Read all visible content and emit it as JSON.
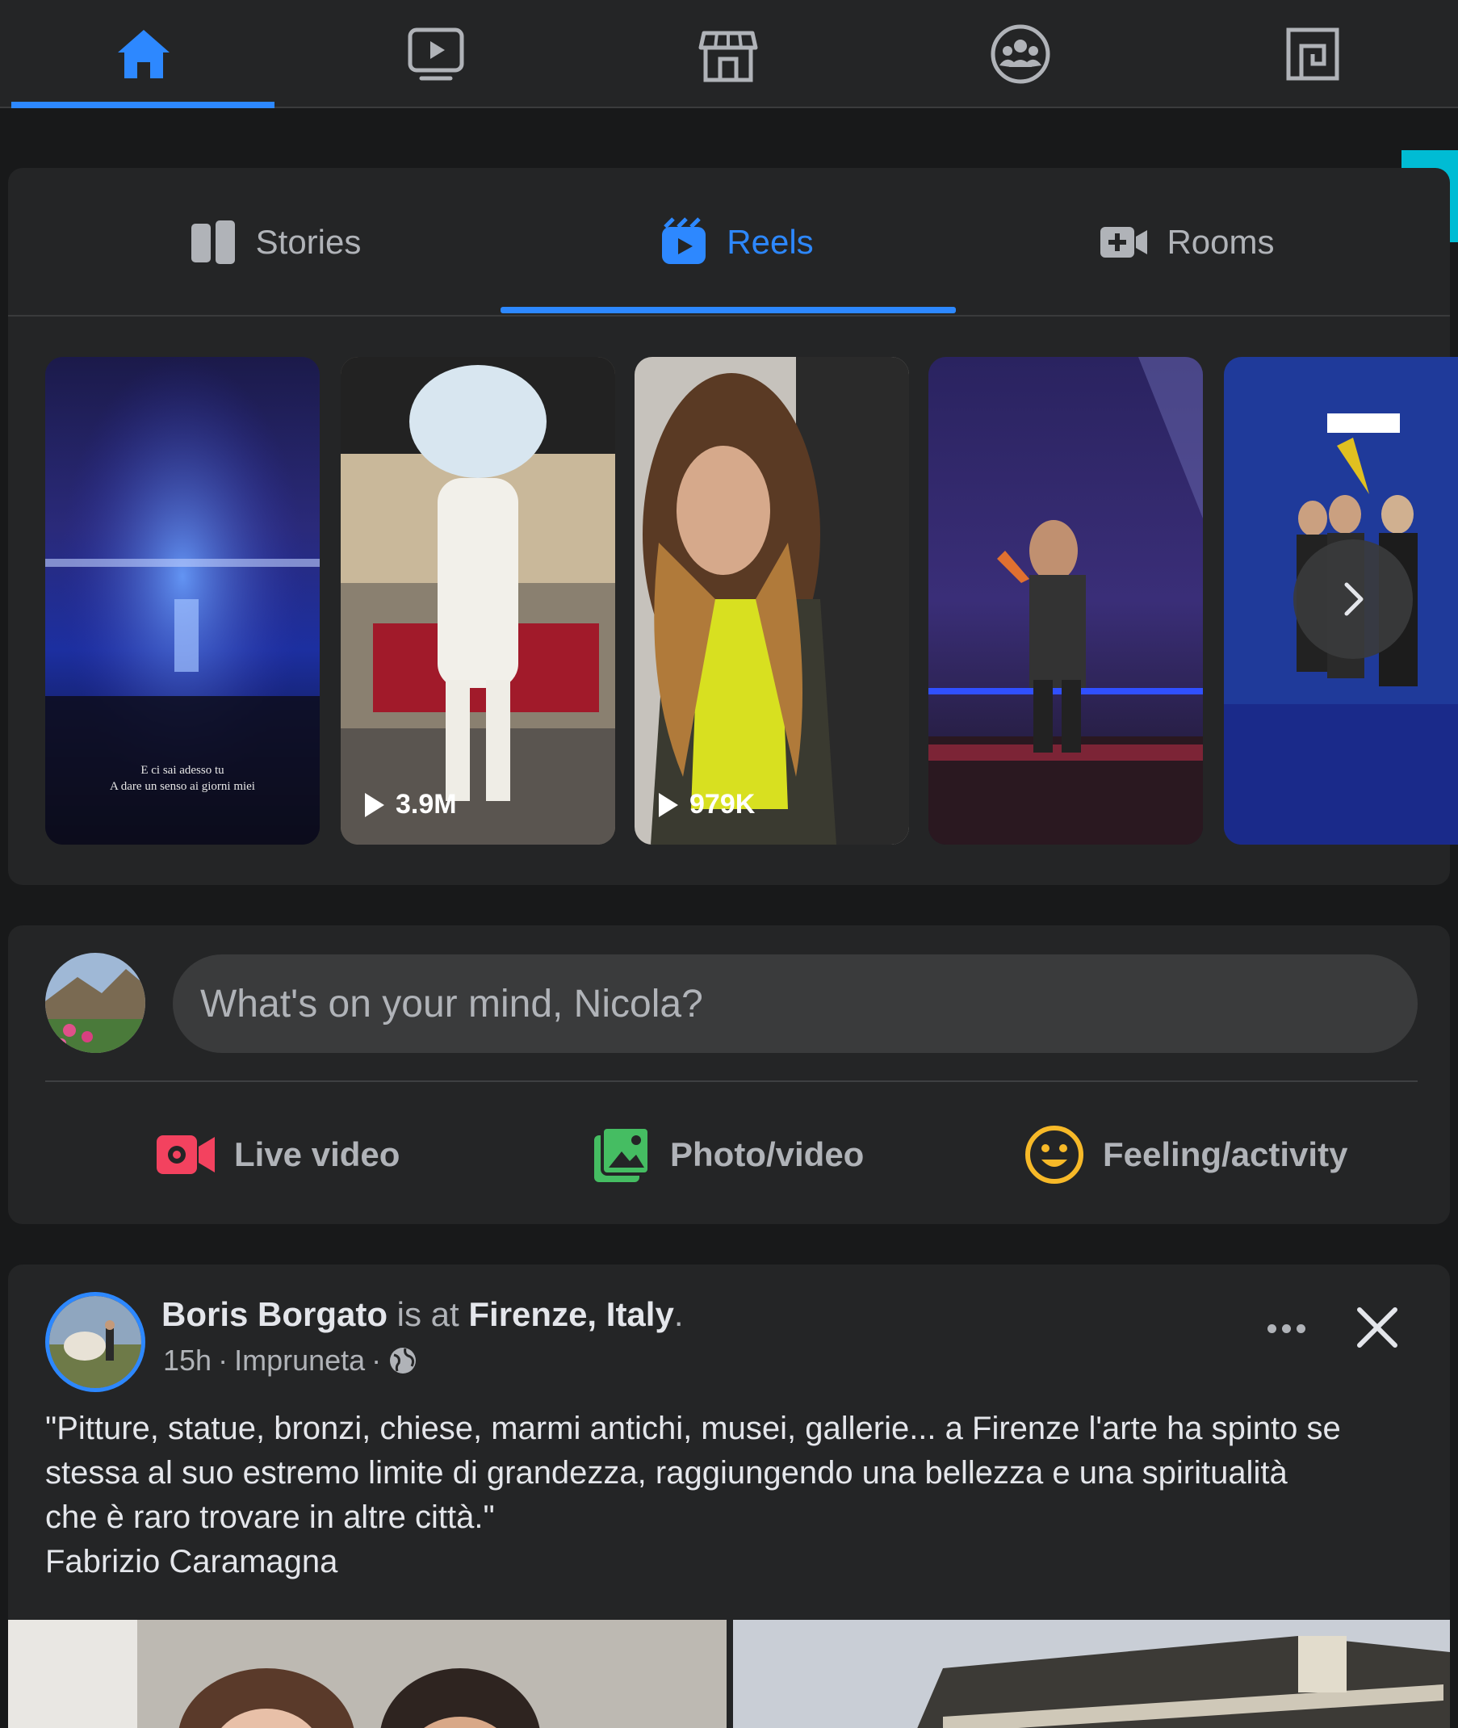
{
  "nav": {
    "items": [
      {
        "name": "home",
        "icon": "home-icon",
        "active": true
      },
      {
        "name": "watch",
        "icon": "video-play-icon",
        "active": false
      },
      {
        "name": "marketplace",
        "icon": "shop-icon",
        "active": false
      },
      {
        "name": "groups",
        "icon": "groups-icon",
        "active": false
      },
      {
        "name": "gaming",
        "icon": "gaming-icon",
        "active": false
      }
    ],
    "accent_color": "#2d88ff"
  },
  "reels_card": {
    "tabs": [
      {
        "label": "Stories",
        "icon": "book-icon",
        "active": false
      },
      {
        "label": "Reels",
        "icon": "reels-icon",
        "active": true
      },
      {
        "label": "Rooms",
        "icon": "video-add-icon",
        "active": false
      }
    ],
    "reels": [
      {
        "views": "",
        "caption_line1": "E ci sai adesso tu",
        "caption_line2": "A dare un senso ai giorni miei"
      },
      {
        "views": "3.9M"
      },
      {
        "views": "979K"
      },
      {
        "views": ""
      },
      {
        "views": ""
      }
    ],
    "next_icon": "chevron-right-icon"
  },
  "composer": {
    "placeholder": "What's on your mind, Nicola?",
    "actions": [
      {
        "label": "Live video",
        "icon": "live-video-icon",
        "color": "#f3425f"
      },
      {
        "label": "Photo/video",
        "icon": "photo-icon",
        "color": "#45bd62"
      },
      {
        "label": "Feeling/activity",
        "icon": "smiley-icon",
        "color": "#f7b928"
      }
    ]
  },
  "post": {
    "author": "Boris Borgato",
    "is_at": " is at ",
    "place": "Firenze, Italy",
    "period": ".",
    "time": "15h",
    "location": "Impruneta",
    "separator": "·",
    "privacy_icon": "globe-icon",
    "text_lines": [
      "\"Pitture, statue, bronzi, chiese, marmi antichi, musei, gallerie... a Firenze l'arte ha spinto se",
      "stessa al suo estremo limite di grandezza, raggiungendo una bellezza e una spiritualità",
      "che è raro trovare in altre città.\"",
      "Fabrizio Caramagna"
    ]
  }
}
